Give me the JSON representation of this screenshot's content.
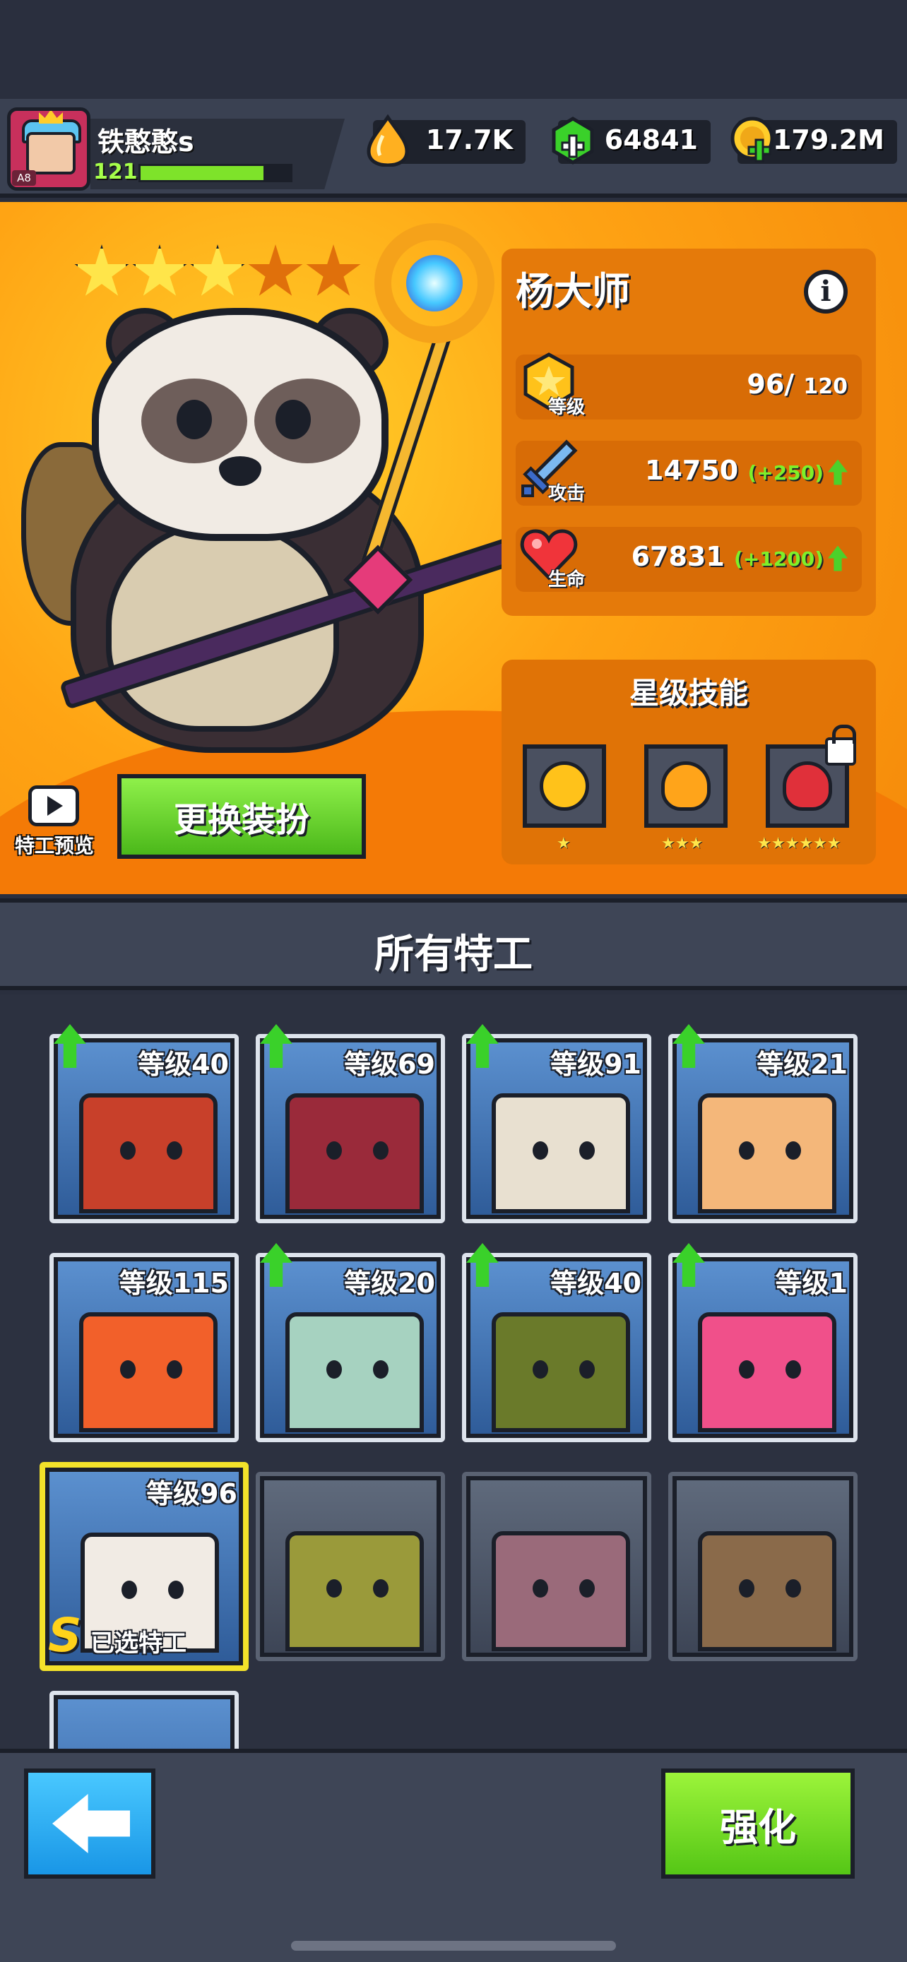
{
  "player": {
    "name": "铁憨憨s",
    "level": "121",
    "avatar_tag": "A8",
    "xp_progress": 0.82
  },
  "currencies": [
    {
      "id": "energy",
      "icon": "flame-drop-icon",
      "value": "17.7K",
      "color": "#ffb020"
    },
    {
      "id": "gems",
      "icon": "green-gem-plus-icon",
      "value": "64841",
      "color": "#3ad12a"
    },
    {
      "id": "coins",
      "icon": "gold-coin-plus-icon",
      "value": "179.2M",
      "color": "#ffcd2a"
    }
  ],
  "hero": {
    "name": "杨大师",
    "stars_filled": 3,
    "stars_total": 5,
    "stats": {
      "level": {
        "label": "等级",
        "value": "96/",
        "max": "120"
      },
      "attack": {
        "label": "攻击",
        "value": "14750",
        "bonus": "(+250)"
      },
      "health": {
        "label": "生命",
        "value": "67831",
        "bonus": "(+1200)"
      }
    },
    "skills_title": "星级技能",
    "skills": [
      {
        "icon": "yin-yang-icon",
        "stars": "★",
        "locked": false
      },
      {
        "icon": "flame-spirit-icon",
        "stars": "★★★",
        "locked": false
      },
      {
        "icon": "red-demon-flame-icon",
        "stars": "★★★★★★",
        "locked": true
      }
    ],
    "preview_label": "特工预览",
    "change_outfit_label": "更换装扮"
  },
  "agents_section": {
    "title": "所有特工",
    "agents": [
      {
        "level": "等级40",
        "upgradable": true,
        "color": "#c8402a",
        "locked": false
      },
      {
        "level": "等级69",
        "upgradable": true,
        "color": "#9a2a3a",
        "locked": false
      },
      {
        "level": "等级91",
        "upgradable": true,
        "color": "#e8e0d0",
        "locked": false
      },
      {
        "level": "等级21",
        "upgradable": true,
        "color": "#f4b77a",
        "locked": false
      },
      {
        "level": "等级115",
        "upgradable": false,
        "color": "#f2602a",
        "locked": false
      },
      {
        "level": "等级20",
        "upgradable": true,
        "color": "#a6d2c0",
        "locked": false
      },
      {
        "level": "等级40",
        "upgradable": true,
        "color": "#6a7a2a",
        "locked": false
      },
      {
        "level": "等级1",
        "upgradable": true,
        "color": "#f0508a",
        "locked": false
      },
      {
        "level": "等级96",
        "upgradable": false,
        "color": "#f1ebe4",
        "locked": false,
        "selected": true,
        "rank": "S",
        "selected_label": "已选特工"
      },
      {
        "level": "",
        "upgradable": false,
        "color": "#9a9a3a",
        "locked": true
      },
      {
        "level": "",
        "upgradable": false,
        "color": "#9a6a7a",
        "locked": true
      },
      {
        "level": "",
        "upgradable": false,
        "color": "#8a6a4a",
        "locked": true
      },
      {
        "level": "",
        "upgradable": false,
        "color": "#c84a2a",
        "locked": false
      }
    ]
  },
  "footer": {
    "back_icon": "left-arrow-icon",
    "upgrade_label": "强化"
  }
}
